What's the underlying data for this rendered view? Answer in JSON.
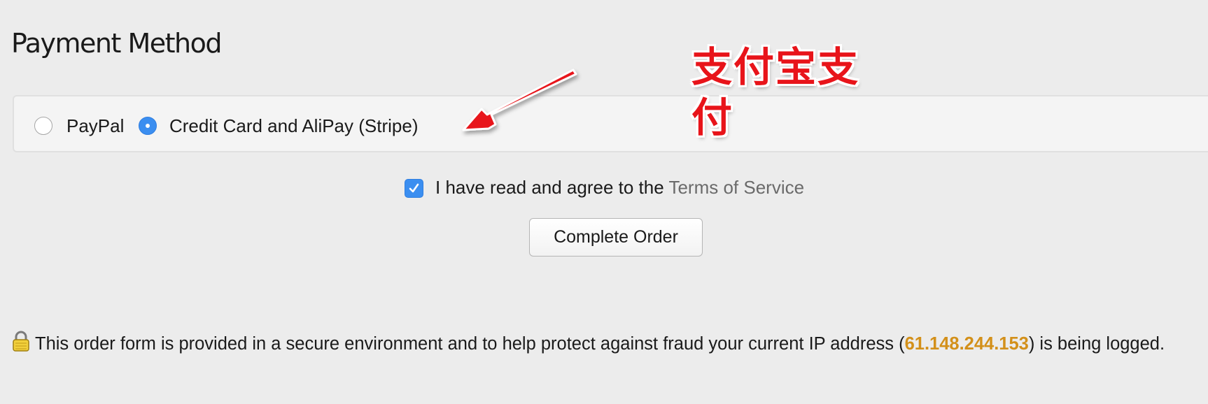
{
  "page": {
    "title": "Payment Method"
  },
  "payment": {
    "options": [
      {
        "label": "PayPal",
        "selected": false
      },
      {
        "label": "Credit Card and AliPay (Stripe)",
        "selected": true
      }
    ]
  },
  "annotation": {
    "text": "支付宝支付",
    "color": "#e8141a",
    "icon": "arrow-icon"
  },
  "terms": {
    "checked": true,
    "text": "I have read and agree to the",
    "link_label": "Terms of Service"
  },
  "actions": {
    "complete_label": "Complete Order"
  },
  "security": {
    "icon": "lock-icon",
    "text_before": "This order form is provided in a secure environment and to help protect against fraud your current IP address (",
    "ip": "61.148.244.153",
    "text_after": ") is being logged.",
    "ip_color": "#d3901a"
  },
  "colors": {
    "background": "#ececec",
    "accent": "#3b8ef0",
    "link": "#6a6a6a"
  }
}
